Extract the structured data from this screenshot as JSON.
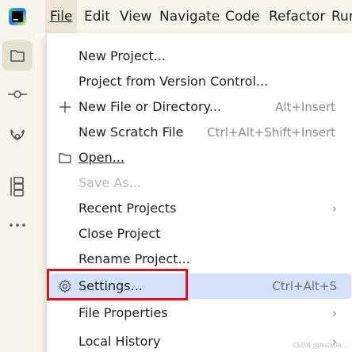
{
  "menubar": {
    "items": [
      {
        "name": "menubar-file",
        "label": "File"
      },
      {
        "name": "menubar-edit",
        "label": "Edit"
      },
      {
        "name": "menubar-view",
        "label": "View"
      },
      {
        "name": "menubar-navigate",
        "label": "Navigate"
      },
      {
        "name": "menubar-code",
        "label": "Code"
      },
      {
        "name": "menubar-refactor",
        "label": "Refactor"
      },
      {
        "name": "menubar-run",
        "label": "Run"
      }
    ]
  },
  "toolstrip": {
    "icons": [
      "folder-icon",
      "commit-icon",
      "git-branch-icon",
      "structure-icon",
      "more-icon"
    ]
  },
  "file_menu": {
    "items": [
      {
        "label": "New Project...",
        "shortcut": ""
      },
      {
        "label": "Project from Version Control...",
        "shortcut": ""
      },
      {
        "label": "New File or Directory...",
        "shortcut": "Alt+Insert",
        "icon": "plus-icon"
      },
      {
        "label": "New Scratch File",
        "shortcut": "Ctrl+Alt+Shift+Insert"
      },
      {
        "label": "Open...",
        "shortcut": "",
        "icon": "folder-icon"
      },
      {
        "label": "Save As...",
        "shortcut": "",
        "disabled": true
      },
      {
        "label": "Recent Projects",
        "submenu": true
      },
      {
        "label": "Close Project",
        "shortcut": ""
      },
      {
        "label": "Rename Project...",
        "shortcut": ""
      },
      {
        "label": "Settings...",
        "shortcut": "Ctrl+Alt+S",
        "icon": "gear-icon",
        "highlighted": true
      },
      {
        "label": "File Properties",
        "submenu": true
      },
      {
        "label": "Local History",
        "submenu": true
      }
    ]
  },
  "colors": {
    "highlight": "#d4e2ff",
    "callout_border": "#e0101c"
  },
  "watermark": "CSDN @Aurelia..."
}
